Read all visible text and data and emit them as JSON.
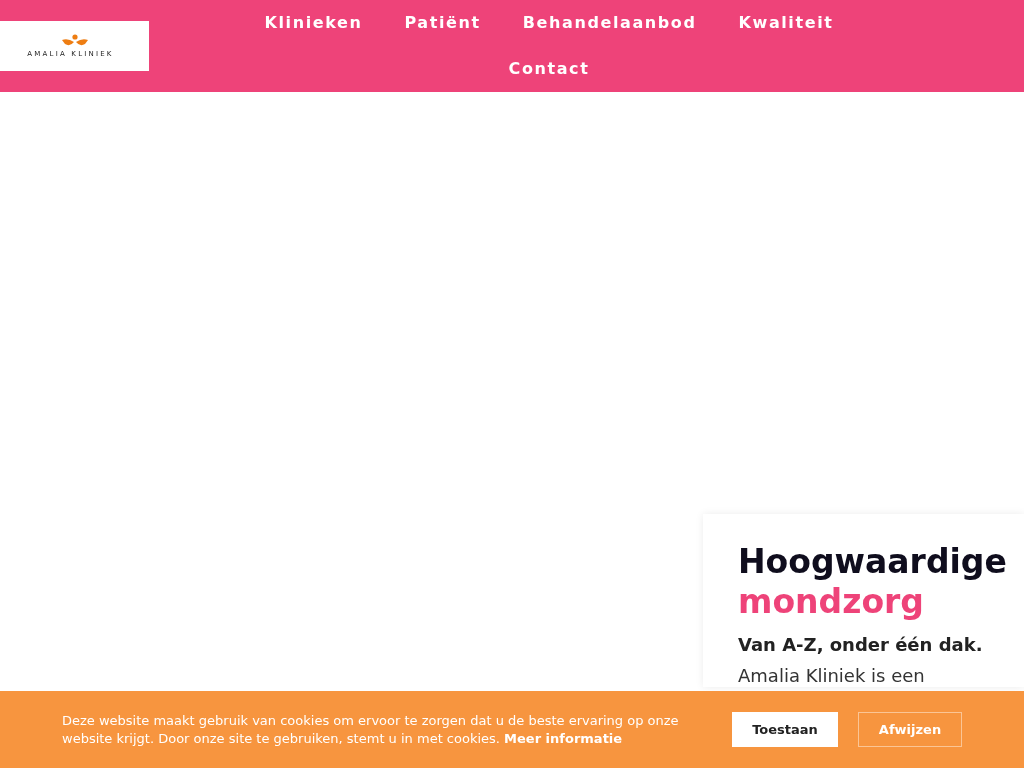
{
  "header": {
    "logo": {
      "text": "AMALIA KLINIEK"
    },
    "nav": [
      {
        "label": "Klinieken"
      },
      {
        "label": "Patiënt"
      },
      {
        "label": "Behandelaanbod"
      },
      {
        "label": "Kwaliteit"
      },
      {
        "label": "Contact"
      }
    ]
  },
  "hero_card": {
    "title": "Hoogwaardige",
    "title_accent": "mondzorg",
    "subtitle": "Van A-Z, onder één dak.",
    "text": "Amalia Kliniek is een"
  },
  "cookie_bar": {
    "text": "Deze website maakt gebruik van cookies om ervoor te zorgen dat u de beste ervaring op onze website krijgt. Door onze site te gebruiken, stemt u in met cookies.",
    "link": "Meer informatie",
    "buttons": [
      {
        "label": "Toestaan",
        "kind": "primary"
      },
      {
        "label": "Afwijzen",
        "kind": "outline"
      }
    ]
  }
}
